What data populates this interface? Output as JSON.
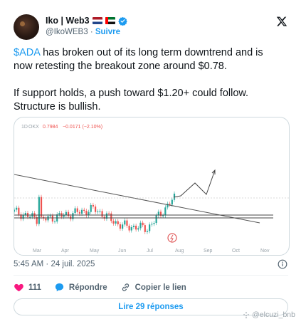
{
  "author": {
    "name": "Iko | Web3",
    "handle": "@IkoWEB3",
    "separator": "·",
    "follow_label": "Suivre",
    "flags": [
      "netherlands-flag",
      "uae-flag"
    ],
    "verified": true
  },
  "tweet": {
    "line1_cashtag": "$ADA",
    "line1_rest": " has broken out of its long term downtrend and is now retesting the breakout zone around $0.78.",
    "line2": "If support holds, a push toward $1.20+ could follow. Structure is bullish."
  },
  "chart": {
    "interval": "1D",
    "exchange": "OKX",
    "price": "0.7984",
    "change": "−0.0171 (−2.10%)",
    "months": [
      "Mar",
      "Apr",
      "May",
      "Jun",
      "Jul",
      "Aug",
      "Sep",
      "Oct",
      "Nov"
    ],
    "colors": {
      "up": "#26a69a",
      "down": "#ef5350",
      "line": "#555555",
      "projection": "#444444"
    }
  },
  "chart_data": {
    "type": "line",
    "title": "",
    "x": [
      "Mar",
      "Apr",
      "May",
      "Jun",
      "Jul",
      "Aug",
      "Sep",
      "Oct",
      "Nov"
    ],
    "series": [
      {
        "values": [
          0.72,
          0.66,
          0.7,
          0.74,
          0.62,
          0.6,
          0.82
        ]
      }
    ],
    "ylim": [
      0.5,
      1.3
    ]
  },
  "meta": {
    "time": "5:45 AM",
    "date": "24 juil. 2025"
  },
  "actions": {
    "likes": "111",
    "reply_label": "Répondre",
    "copy_label": "Copier le lien"
  },
  "replies_button": "Lire 29 réponses",
  "watermark": "@elcuzi_bnb"
}
